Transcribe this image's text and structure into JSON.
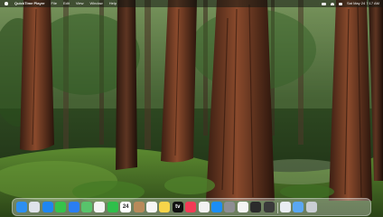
{
  "menubar": {
    "app_name": "QuickTime Player",
    "items": [
      "File",
      "Edit",
      "View",
      "Window",
      "Help"
    ],
    "clock": "Sat May 24  7:17 AM"
  },
  "dock": {
    "apps": [
      {
        "name": "finder-icon",
        "color": "#2d8ff0"
      },
      {
        "name": "launchpad-icon",
        "color": "#dfe3ea"
      },
      {
        "name": "safari-icon",
        "color": "#1f86f0"
      },
      {
        "name": "messages-icon",
        "color": "#36c34a"
      },
      {
        "name": "mail-icon",
        "color": "#2a7ef2"
      },
      {
        "name": "maps-icon",
        "color": "#58c36b"
      },
      {
        "name": "photos-icon",
        "color": "#f4f4f4"
      },
      {
        "name": "facetime-icon",
        "color": "#2fbf4a"
      },
      {
        "name": "calendar-icon",
        "color": "#ffffff",
        "label": "24"
      },
      {
        "name": "contacts-icon",
        "color": "#b88a5a"
      },
      {
        "name": "reminders-icon",
        "color": "#f6f6f6"
      },
      {
        "name": "notes-icon",
        "color": "#f7d54a"
      },
      {
        "name": "tv-icon",
        "color": "#111111",
        "label": "tv"
      },
      {
        "name": "music-icon",
        "color": "#f33b55"
      },
      {
        "name": "news-icon",
        "color": "#f2f2f2"
      },
      {
        "name": "app-store-icon",
        "color": "#1b8ef5"
      },
      {
        "name": "system-settings-icon",
        "color": "#8e8e93"
      },
      {
        "name": "chrome-icon",
        "color": "#f4f4f4"
      },
      {
        "name": "terminal-icon",
        "color": "#2b2b2b"
      },
      {
        "name": "quicktime-icon",
        "color": "#3a3a3a"
      }
    ],
    "stacks": [
      {
        "name": "documents-icon",
        "color": "#e9edf2"
      },
      {
        "name": "downloads-icon",
        "color": "#5aa7f2"
      },
      {
        "name": "trash-icon",
        "color": "#c9cdd3"
      }
    ]
  }
}
